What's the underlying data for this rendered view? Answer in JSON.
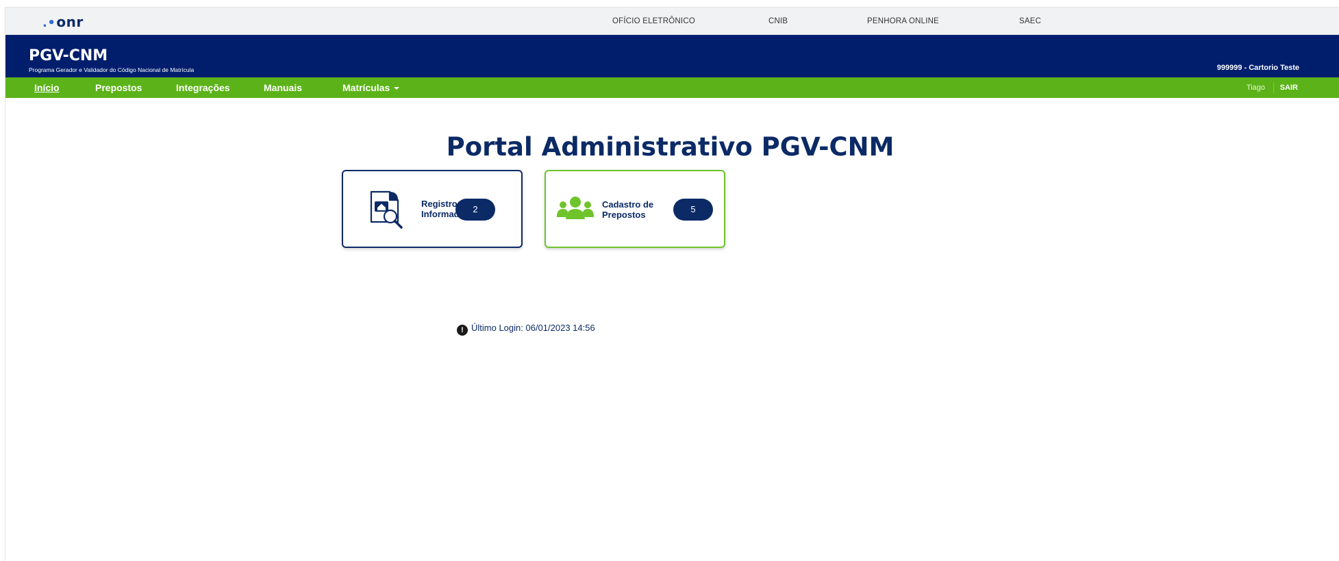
{
  "topbar": {
    "logo": ".onr",
    "logo_dots": ".•",
    "logo_text": "onr",
    "links": [
      "OFÍCIO ELETRÔNICO",
      "CNIB",
      "PENHORA ONLINE",
      "SAEC"
    ]
  },
  "brand": {
    "title": "PGV-CNM",
    "subtitle": "Programa Gerador e Validador do Código Nacional de Matrícula",
    "org": "999999 - Cartorio Teste"
  },
  "nav": {
    "items": [
      "Início",
      "Prepostos",
      "Integrações",
      "Manuais",
      "Matrículas"
    ],
    "user": "Tiago",
    "logout": "SAIR"
  },
  "main": {
    "title": "Portal Administrativo PGV-CNM",
    "cards": [
      {
        "label_line1": "Registros",
        "label_line2": "Informados",
        "count": "2",
        "icon": "house-document-search-icon"
      },
      {
        "label_line1": "Cadastro de",
        "label_line2": "Prepostos",
        "count": "5",
        "icon": "users-group-icon"
      }
    ],
    "last_login": "Último Login: 06/01/2023 14:56"
  },
  "colors": {
    "navy": "#011e6d",
    "green": "#5cb319",
    "text": "#0b2a66"
  }
}
